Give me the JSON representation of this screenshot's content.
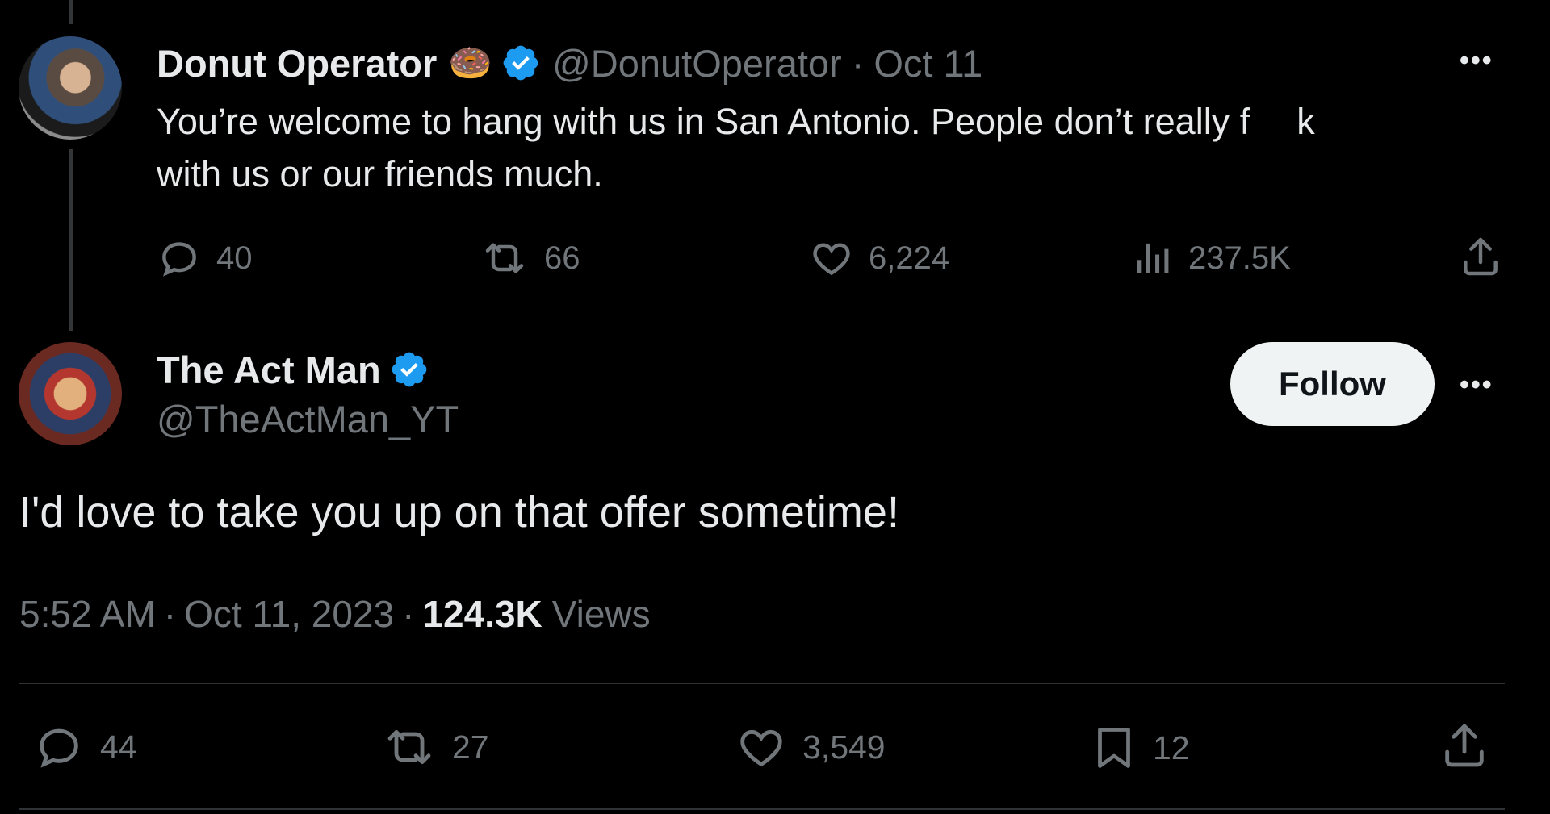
{
  "parent_tweet": {
    "display_name": "Donut Operator",
    "emoji": "🍩",
    "handle": "@DonutOperator",
    "separator": "·",
    "date": "Oct 11",
    "text_line1": "You’re welcome to hang with us in San Antonio. People don’t really f",
    "text_gap_char": "k",
    "text_line2": "with us or our friends much.",
    "stats": {
      "replies": "40",
      "reposts": "66",
      "likes": "6,224",
      "views": "237.5K"
    },
    "more_label": "•••"
  },
  "main_tweet": {
    "display_name": "The Act Man",
    "handle": "@TheActMan_YT",
    "follow_label": "Follow",
    "more_label": "•••",
    "text": "I'd love to take you up on that offer sometime!",
    "time": "5:52 AM",
    "separator": "·",
    "date": "Oct 11, 2023",
    "views_count": "124.3K",
    "views_label": "Views",
    "stats": {
      "replies": "44",
      "reposts": "27",
      "likes": "3,549",
      "bookmarks": "12"
    }
  },
  "colors": {
    "background": "#000000",
    "text": "#e7e9ea",
    "muted": "#71767b",
    "verified": "#1d9bf0",
    "follow_bg": "#eff3f4",
    "divider": "#2f3336"
  }
}
